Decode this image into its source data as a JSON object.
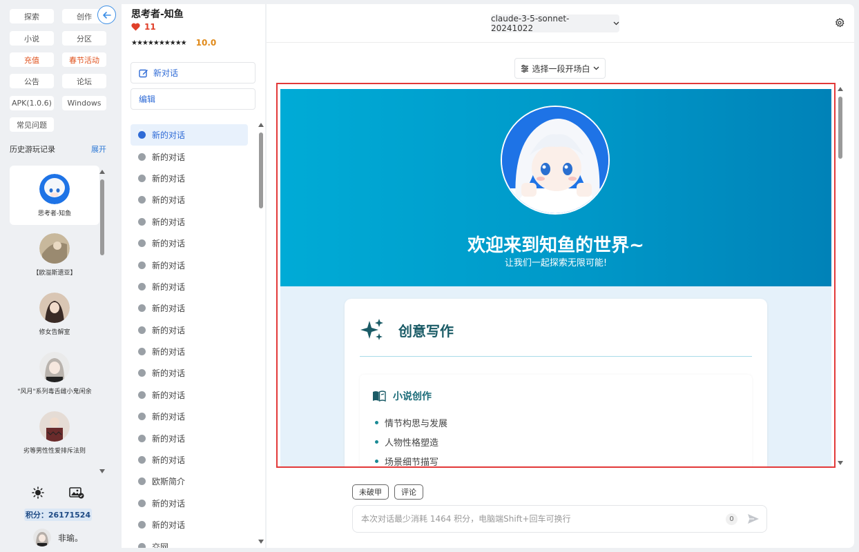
{
  "nav": {
    "buttons": [
      {
        "label": "探索"
      },
      {
        "label": "创作"
      },
      {
        "label": "小说"
      },
      {
        "label": "分区"
      },
      {
        "label": "充值"
      },
      {
        "label": "春节活动"
      },
      {
        "label": "公告"
      },
      {
        "label": "论坛"
      },
      {
        "label": "APK(1.0.6)"
      },
      {
        "label": "Windows"
      },
      {
        "label": "常见问题"
      }
    ],
    "history_label": "历史游玩记录",
    "history_toggle": "展开",
    "characters": [
      {
        "name": "思考者-知鱼"
      },
      {
        "name": "【欧溢斯遗亚】"
      },
      {
        "name": "修女告解室"
      },
      {
        "name": "\"风月\"系列毒舌雌小鬼闲余"
      },
      {
        "name": "劣等男性性爱排斥法则"
      }
    ],
    "points_label": "积分：26171524",
    "user_name": "非瑜。"
  },
  "conversations": {
    "bot_title": "思考者-知鱼",
    "likes": "11",
    "stars": "★★★★★★★★★★",
    "score": "10.0",
    "new_chat_label": "新对话",
    "edit_label": "编辑",
    "items": [
      {
        "label": "新的对话"
      },
      {
        "label": "新的对话"
      },
      {
        "label": "新的对话"
      },
      {
        "label": "新的对话"
      },
      {
        "label": "新的对话"
      },
      {
        "label": "新的对话"
      },
      {
        "label": "新的对话"
      },
      {
        "label": "新的对话"
      },
      {
        "label": "新的对话"
      },
      {
        "label": "新的对话"
      },
      {
        "label": "新的对话"
      },
      {
        "label": "新的对话"
      },
      {
        "label": "新的对话"
      },
      {
        "label": "新的对话"
      },
      {
        "label": "新的对话"
      },
      {
        "label": "新的对话"
      },
      {
        "label": "欧斯简介"
      },
      {
        "label": "新的对话"
      },
      {
        "label": "新的对话"
      },
      {
        "label": "交网"
      }
    ]
  },
  "main": {
    "model": "claude-3-5-sonnet-20241022",
    "opening_label": "选择一段开场白",
    "banner_title": "欢迎来到知鱼的世界~",
    "banner_subtitle": "让我们一起探索无限可能!",
    "card_title": "创意写作",
    "sub_title": "小说创作",
    "bullets": [
      "情节构思与发展",
      "人物性格塑造",
      "场景细节描写"
    ],
    "chips": [
      "未破甲",
      "评论"
    ],
    "input_placeholder": "本次对话最少消耗 1464 积分，电脑端Shift+回车可换行",
    "input_value": "",
    "counter": "0"
  },
  "colors": {
    "accent": "#2f6bd6",
    "banner": "#00a3d2",
    "highlight": "#e0531f",
    "frame": "#e23838"
  }
}
